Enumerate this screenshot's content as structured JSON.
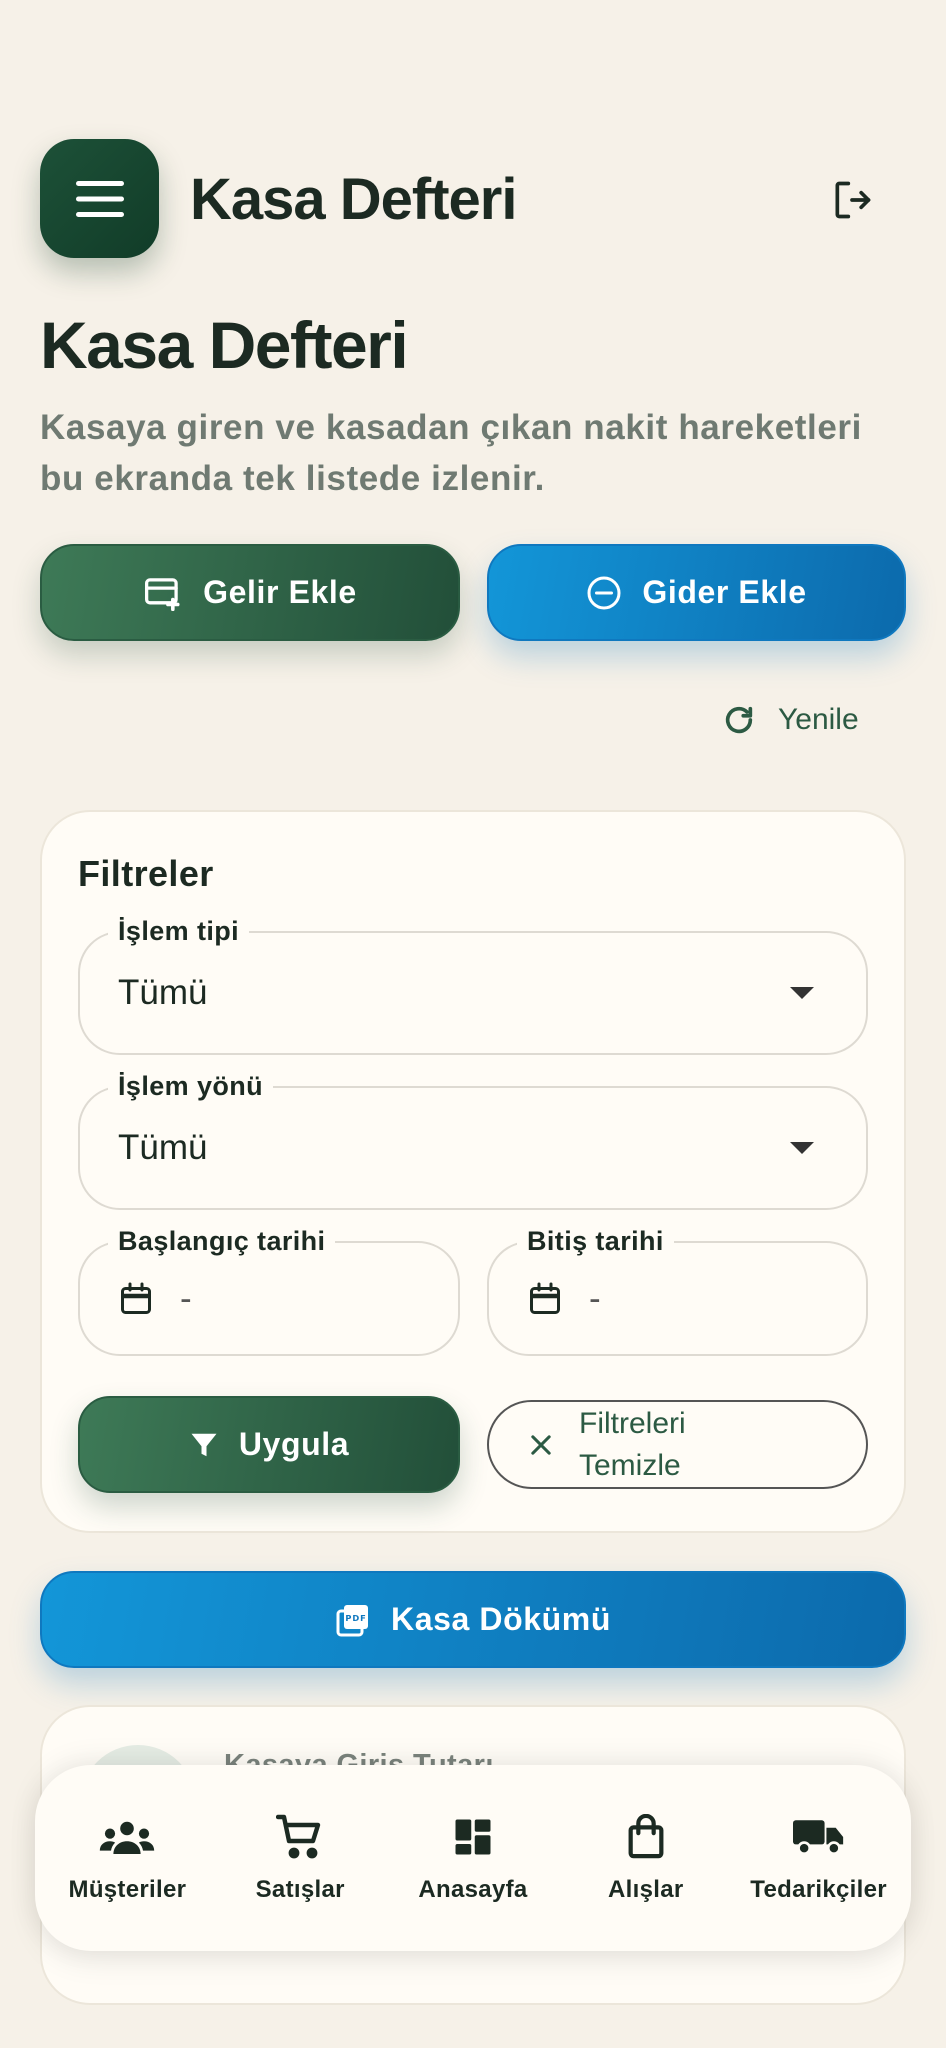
{
  "header": {
    "app_title": "Kasa Defteri",
    "menu_icon": "hamburger-menu-icon",
    "logout_icon": "logout-icon"
  },
  "page": {
    "title": "Kasa Defteri",
    "subtitle": "Kasaya giren ve kasadan çıkan nakit hareketleri bu ekranda tek listede izlenir."
  },
  "actions": {
    "income_label": "Gelir Ekle",
    "expense_label": "Gider Ekle",
    "refresh_label": "Yenile"
  },
  "filters": {
    "title": "Filtreler",
    "type": {
      "label": "İşlem tipi",
      "value": "Tümü"
    },
    "direction": {
      "label": "İşlem yönü",
      "value": "Tümü"
    },
    "start_date": {
      "label": "Başlangıç tarihi",
      "value": "-"
    },
    "end_date": {
      "label": "Bitiş tarihi",
      "value": "-"
    },
    "apply_label": "Uygula",
    "clear_label": "Filtreleri Temizle"
  },
  "report": {
    "label": "Kasa Dökümü"
  },
  "summary_card": {
    "label": "Kasaya Giriş Tutarı"
  },
  "nav": {
    "items": [
      {
        "label": "Müşteriler",
        "icon": "customers-icon"
      },
      {
        "label": "Satışlar",
        "icon": "cart-icon"
      },
      {
        "label": "Anasayfa",
        "icon": "dashboard-icon"
      },
      {
        "label": "Alışlar",
        "icon": "shopping-bag-icon"
      },
      {
        "label": "Tedarikçiler",
        "icon": "truck-icon"
      }
    ]
  },
  "colors": {
    "background": "#f6f1e8",
    "primary_green": "#224f39",
    "primary_blue": "#0f78bf",
    "text": "#1c2a22"
  }
}
